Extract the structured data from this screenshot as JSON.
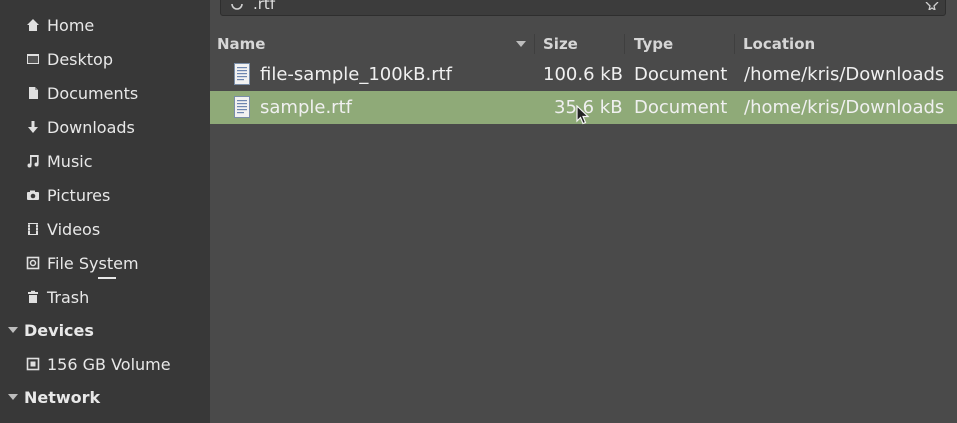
{
  "sidebar": {
    "items": [
      {
        "label": "Home",
        "icon": "home-icon"
      },
      {
        "label": "Desktop",
        "icon": "desktop-icon"
      },
      {
        "label": "Documents",
        "icon": "documents-icon"
      },
      {
        "label": "Downloads",
        "icon": "downloads-icon"
      },
      {
        "label": "Music",
        "icon": "music-icon"
      },
      {
        "label": "Pictures",
        "icon": "pictures-icon"
      },
      {
        "label": "Videos",
        "icon": "videos-icon"
      },
      {
        "label": "File System",
        "icon": "file-system-icon"
      },
      {
        "label": "Trash",
        "icon": "trash-icon"
      }
    ],
    "devices": {
      "header": "Devices",
      "items": [
        {
          "label": "156 GB Volume",
          "icon": "drive-icon"
        }
      ]
    },
    "network": {
      "header": "Network"
    }
  },
  "search": {
    "value": ".rtf"
  },
  "columns": {
    "name": "Name",
    "size": "Size",
    "type": "Type",
    "location": "Location"
  },
  "files": [
    {
      "name": "file-sample_100kB.rtf",
      "size": "100.6 kB",
      "type": "Document",
      "location": "/home/kris/Downloads",
      "selected": false
    },
    {
      "name": "sample.rtf",
      "size": "35.6 kB",
      "type": "Document",
      "location": "/home/kris/Downloads",
      "selected": true
    }
  ],
  "colors": {
    "sidebar_bg": "#383838",
    "main_bg": "#4a4a4a",
    "selection": "#8faa78"
  }
}
